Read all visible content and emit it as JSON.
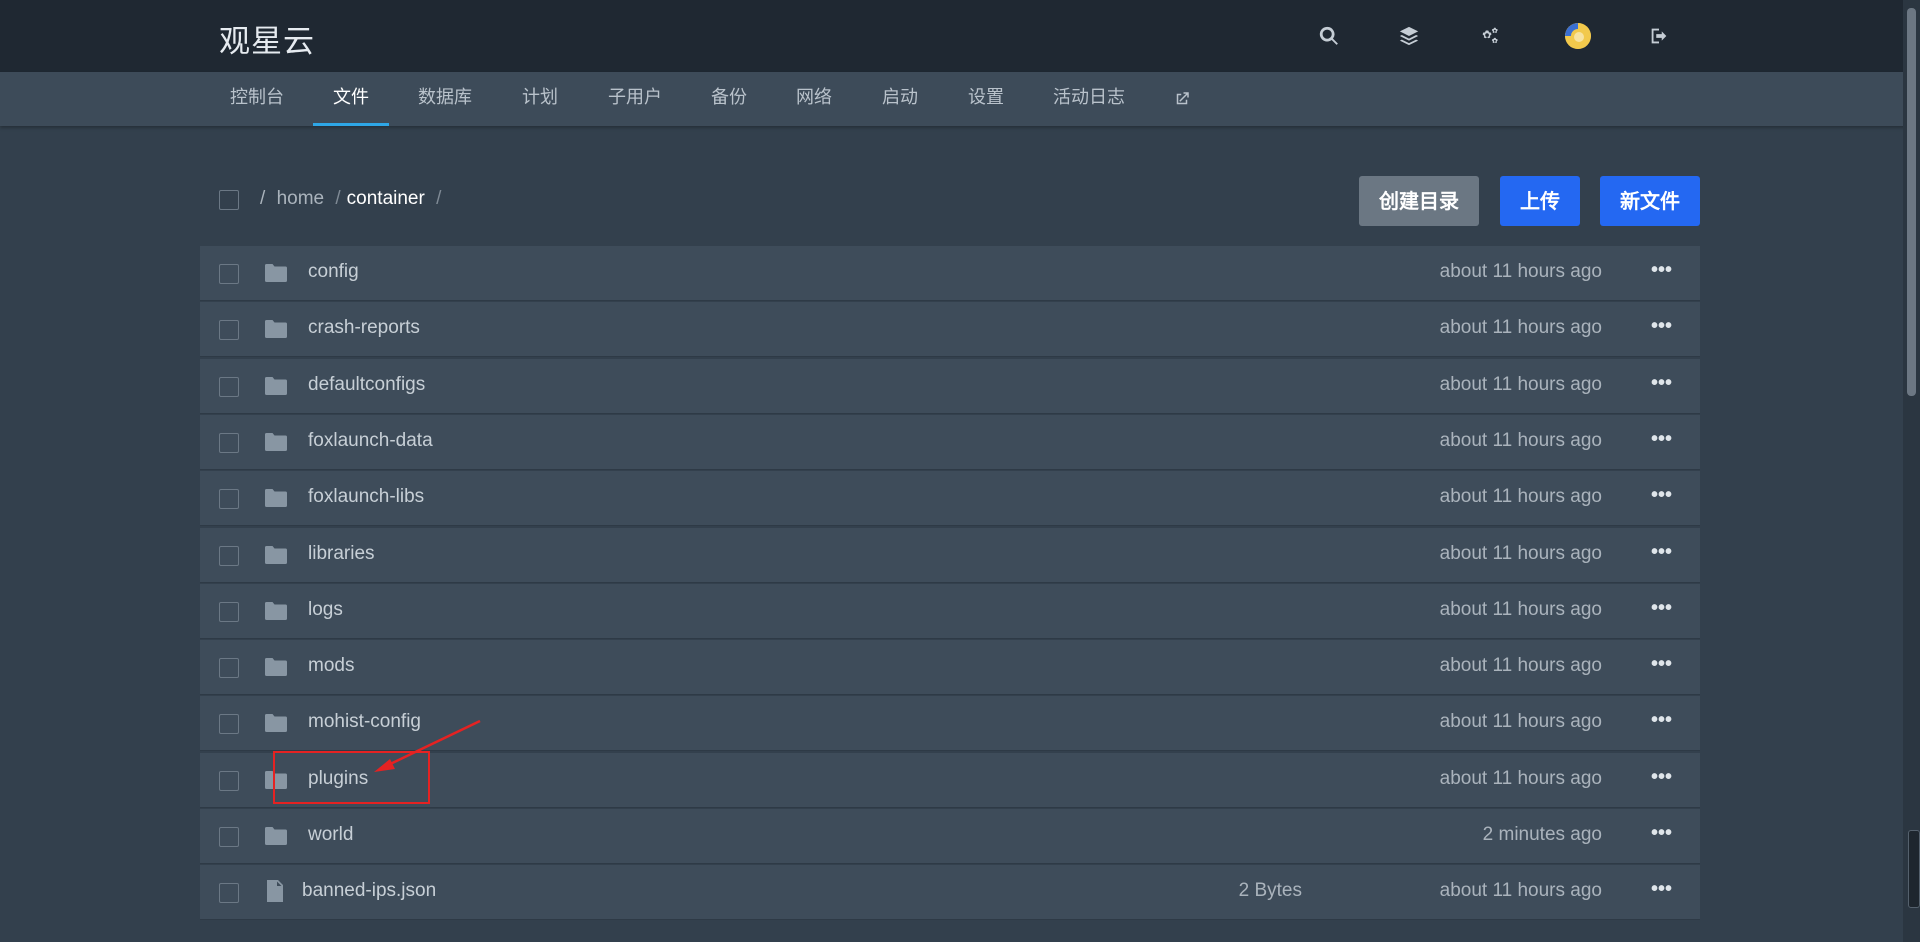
{
  "app": {
    "brand": "观星云"
  },
  "header": {
    "icons": [
      "search-icon",
      "layers-icon",
      "gears-icon",
      "avatar",
      "logout-icon"
    ]
  },
  "nav": {
    "items": [
      "控制台",
      "文件",
      "数据库",
      "计划",
      "子用户",
      "备份",
      "网络",
      "启动",
      "设置",
      "活动日志"
    ],
    "active": "文件"
  },
  "breadcrumb": {
    "root": "/",
    "parts": [
      "home",
      "container"
    ],
    "separator": "/"
  },
  "toolbar": {
    "create_dir": "创建目录",
    "upload": "上传",
    "new_file": "新文件"
  },
  "files": [
    {
      "name": "config",
      "type": "folder",
      "size": "",
      "modified": "about 11 hours ago"
    },
    {
      "name": "crash-reports",
      "type": "folder",
      "size": "",
      "modified": "about 11 hours ago"
    },
    {
      "name": "defaultconfigs",
      "type": "folder",
      "size": "",
      "modified": "about 11 hours ago"
    },
    {
      "name": "foxlaunch-data",
      "type": "folder",
      "size": "",
      "modified": "about 11 hours ago"
    },
    {
      "name": "foxlaunch-libs",
      "type": "folder",
      "size": "",
      "modified": "about 11 hours ago"
    },
    {
      "name": "libraries",
      "type": "folder",
      "size": "",
      "modified": "about 11 hours ago"
    },
    {
      "name": "logs",
      "type": "folder",
      "size": "",
      "modified": "about 11 hours ago"
    },
    {
      "name": "mods",
      "type": "folder",
      "size": "",
      "modified": "about 11 hours ago"
    },
    {
      "name": "mohist-config",
      "type": "folder",
      "size": "",
      "modified": "about 11 hours ago"
    },
    {
      "name": "plugins",
      "type": "folder",
      "size": "",
      "modified": "about 11 hours ago"
    },
    {
      "name": "world",
      "type": "folder",
      "size": "",
      "modified": "2 minutes ago"
    },
    {
      "name": "banned-ips.json",
      "type": "file",
      "size": "2 Bytes",
      "modified": "about 11 hours ago"
    }
  ],
  "more_label": "•••",
  "colors": {
    "accent": "#2468f2",
    "tab_underline": "#2ea6e6",
    "annotation": "#e52222"
  }
}
